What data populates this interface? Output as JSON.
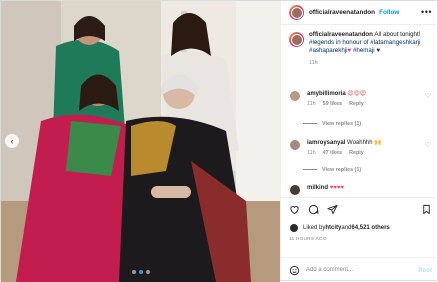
{
  "post": {
    "username": "officialraveenatandon",
    "follow_label": "Follow",
    "more_label": "•••",
    "caption": {
      "username": "officialraveenatandon",
      "text_before": " All about tonight! ",
      "hashtags": "#legends in honour of #latamangeshkarji #ashaparekhji",
      "heart": "♥",
      "hashtag_end": " #hemaji",
      "heart2": " ♥",
      "time": "11h"
    },
    "comments": [
      {
        "username": "amybillimoria",
        "text": "😍😍😍",
        "time": "11h",
        "likes": "59 likes",
        "reply": "Reply",
        "view_replies": "View replies (1)"
      },
      {
        "username": "iamroysanyal",
        "text": "Woahhhh 🙌",
        "time": "11h",
        "likes": "47 likes",
        "reply": "Reply",
        "view_replies": "View replies (1)"
      },
      {
        "username": "milkind",
        "text": "♥♥♥♥"
      }
    ],
    "likes": {
      "prefix": "Liked by ",
      "user": "htcity",
      "mid": " and ",
      "count": "64,521 others"
    },
    "timestamp": "11 HOURS AGO",
    "add_comment_placeholder": "Add a comment...",
    "post_label": "Post"
  },
  "media": {
    "prev_arrow": "‹",
    "next_arrow": "›",
    "slide_count": 3,
    "active_slide": 1
  },
  "colors": {
    "link_blue": "#0095f6",
    "hashtag": "#00376b",
    "muted": "#8e8e8e",
    "heart_red": "#ed4956"
  }
}
